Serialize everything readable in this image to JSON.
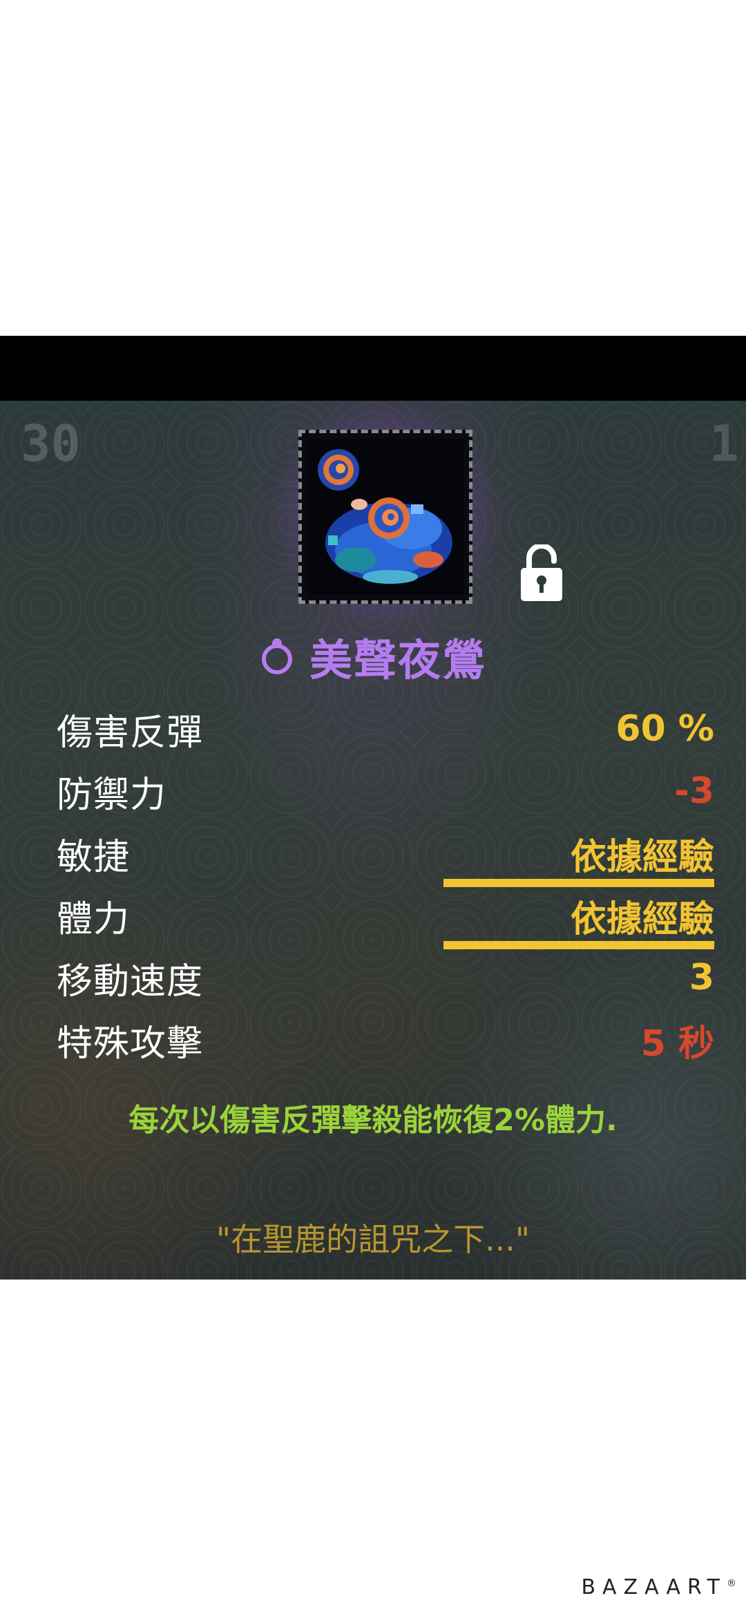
{
  "hud": {
    "level_number": "30",
    "corner_marker": "1"
  },
  "item": {
    "name": "美聲夜鶯",
    "icon": "nightingale-pixel-art",
    "lock_state": "unlocked"
  },
  "stats": [
    {
      "label": "傷害反彈",
      "value": "60 %",
      "color": "#f2c431"
    },
    {
      "label": "防禦力",
      "value": "-3",
      "color": "#d6492b"
    },
    {
      "label": "敏捷",
      "value": "依據經驗",
      "color": "#f2c431"
    },
    {
      "label": "體力",
      "value": "依據經驗",
      "color": "#f2c431"
    },
    {
      "label": "移動速度",
      "value": "3",
      "color": "#f2c431"
    },
    {
      "label": "特殊攻擊",
      "value": "5 秒",
      "color": "#d6492b"
    }
  ],
  "effect_text": "每次以傷害反彈擊殺能恢復2%體力.",
  "flavor_quote": "\"在聖鹿的詛咒之下...\"",
  "watermark": {
    "text": "BAZAART",
    "mark": "®"
  },
  "colors": {
    "item_name": "#b57cf0",
    "positive_value": "#f2c431",
    "negative_value": "#d6492b",
    "effect": "#9bd43a",
    "quote": "#b8962e"
  }
}
